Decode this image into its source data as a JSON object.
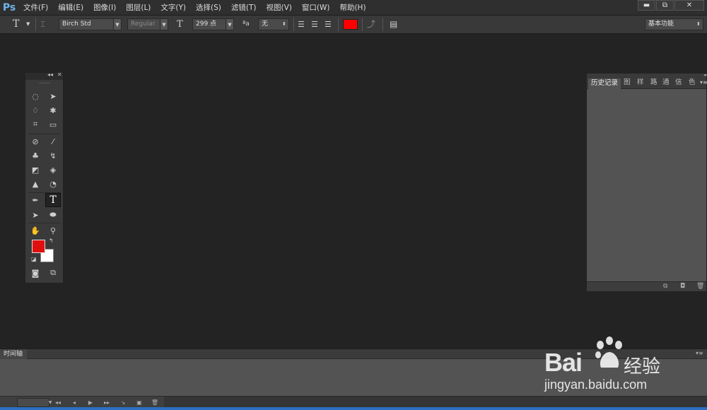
{
  "app": {
    "logo": "Ps"
  },
  "menu": [
    "文件(F)",
    "编辑(E)",
    "图像(I)",
    "图层(L)",
    "文字(Y)",
    "选择(S)",
    "滤镜(T)",
    "视图(V)",
    "窗口(W)",
    "帮助(H)"
  ],
  "window_controls": {
    "minimize": "▬",
    "restore": "⧉",
    "close": "✕"
  },
  "options": {
    "tool_glyph": "T",
    "font_family": "Birch Std",
    "font_style": "Regular",
    "font_size": "299 点",
    "antialias_glyph": "ªa",
    "antialias": "无",
    "text_color": "#ff0000",
    "workspace": "基本功能"
  },
  "tools": {
    "foreground_color": "#e01010",
    "background_color": "#ffffff"
  },
  "history": {
    "tabs": [
      "历史记录",
      "图",
      "样",
      "路",
      "通",
      "信",
      "色"
    ],
    "active_tab": "历史记录"
  },
  "timeline": {
    "tab": "时间轴"
  },
  "watermark": {
    "brand": "Bai",
    "brand_cn": "经验",
    "url": "jingyan.baidu.com"
  }
}
